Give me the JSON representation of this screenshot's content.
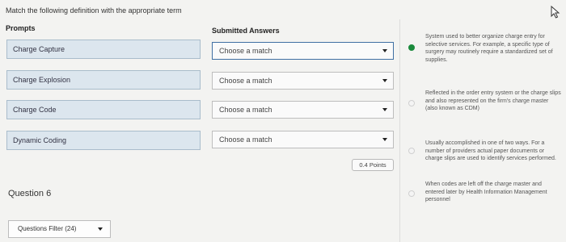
{
  "instruction": "Match the following definition with the appropriate term",
  "headers": {
    "prompts": "Prompts",
    "answers": "Submitted Answers"
  },
  "prompts": [
    "Charge Capture",
    "Charge Explosion",
    "Charge Code",
    "Dynamic Coding"
  ],
  "answers": [
    "Choose a match",
    "Choose a match",
    "Choose a match",
    "Choose a match"
  ],
  "definitions": [
    "System used to better organize charge entry for selective services. For example, a specific type of surgery may routinely require a standardized set of supplies.",
    "Reflected in the order entry system or the charge slips and also represented on the firm's charge master (also known as CDM)",
    "Usually accomplished in one of two ways. For a number of providers actual paper documents or charge slips are used to identify services performed.",
    "When codes are left off the charge master and entered later by Health Information Management personnel"
  ],
  "question_label": "Question 6",
  "points": "0.4 Points",
  "filter_label": "Questions Filter (24)"
}
